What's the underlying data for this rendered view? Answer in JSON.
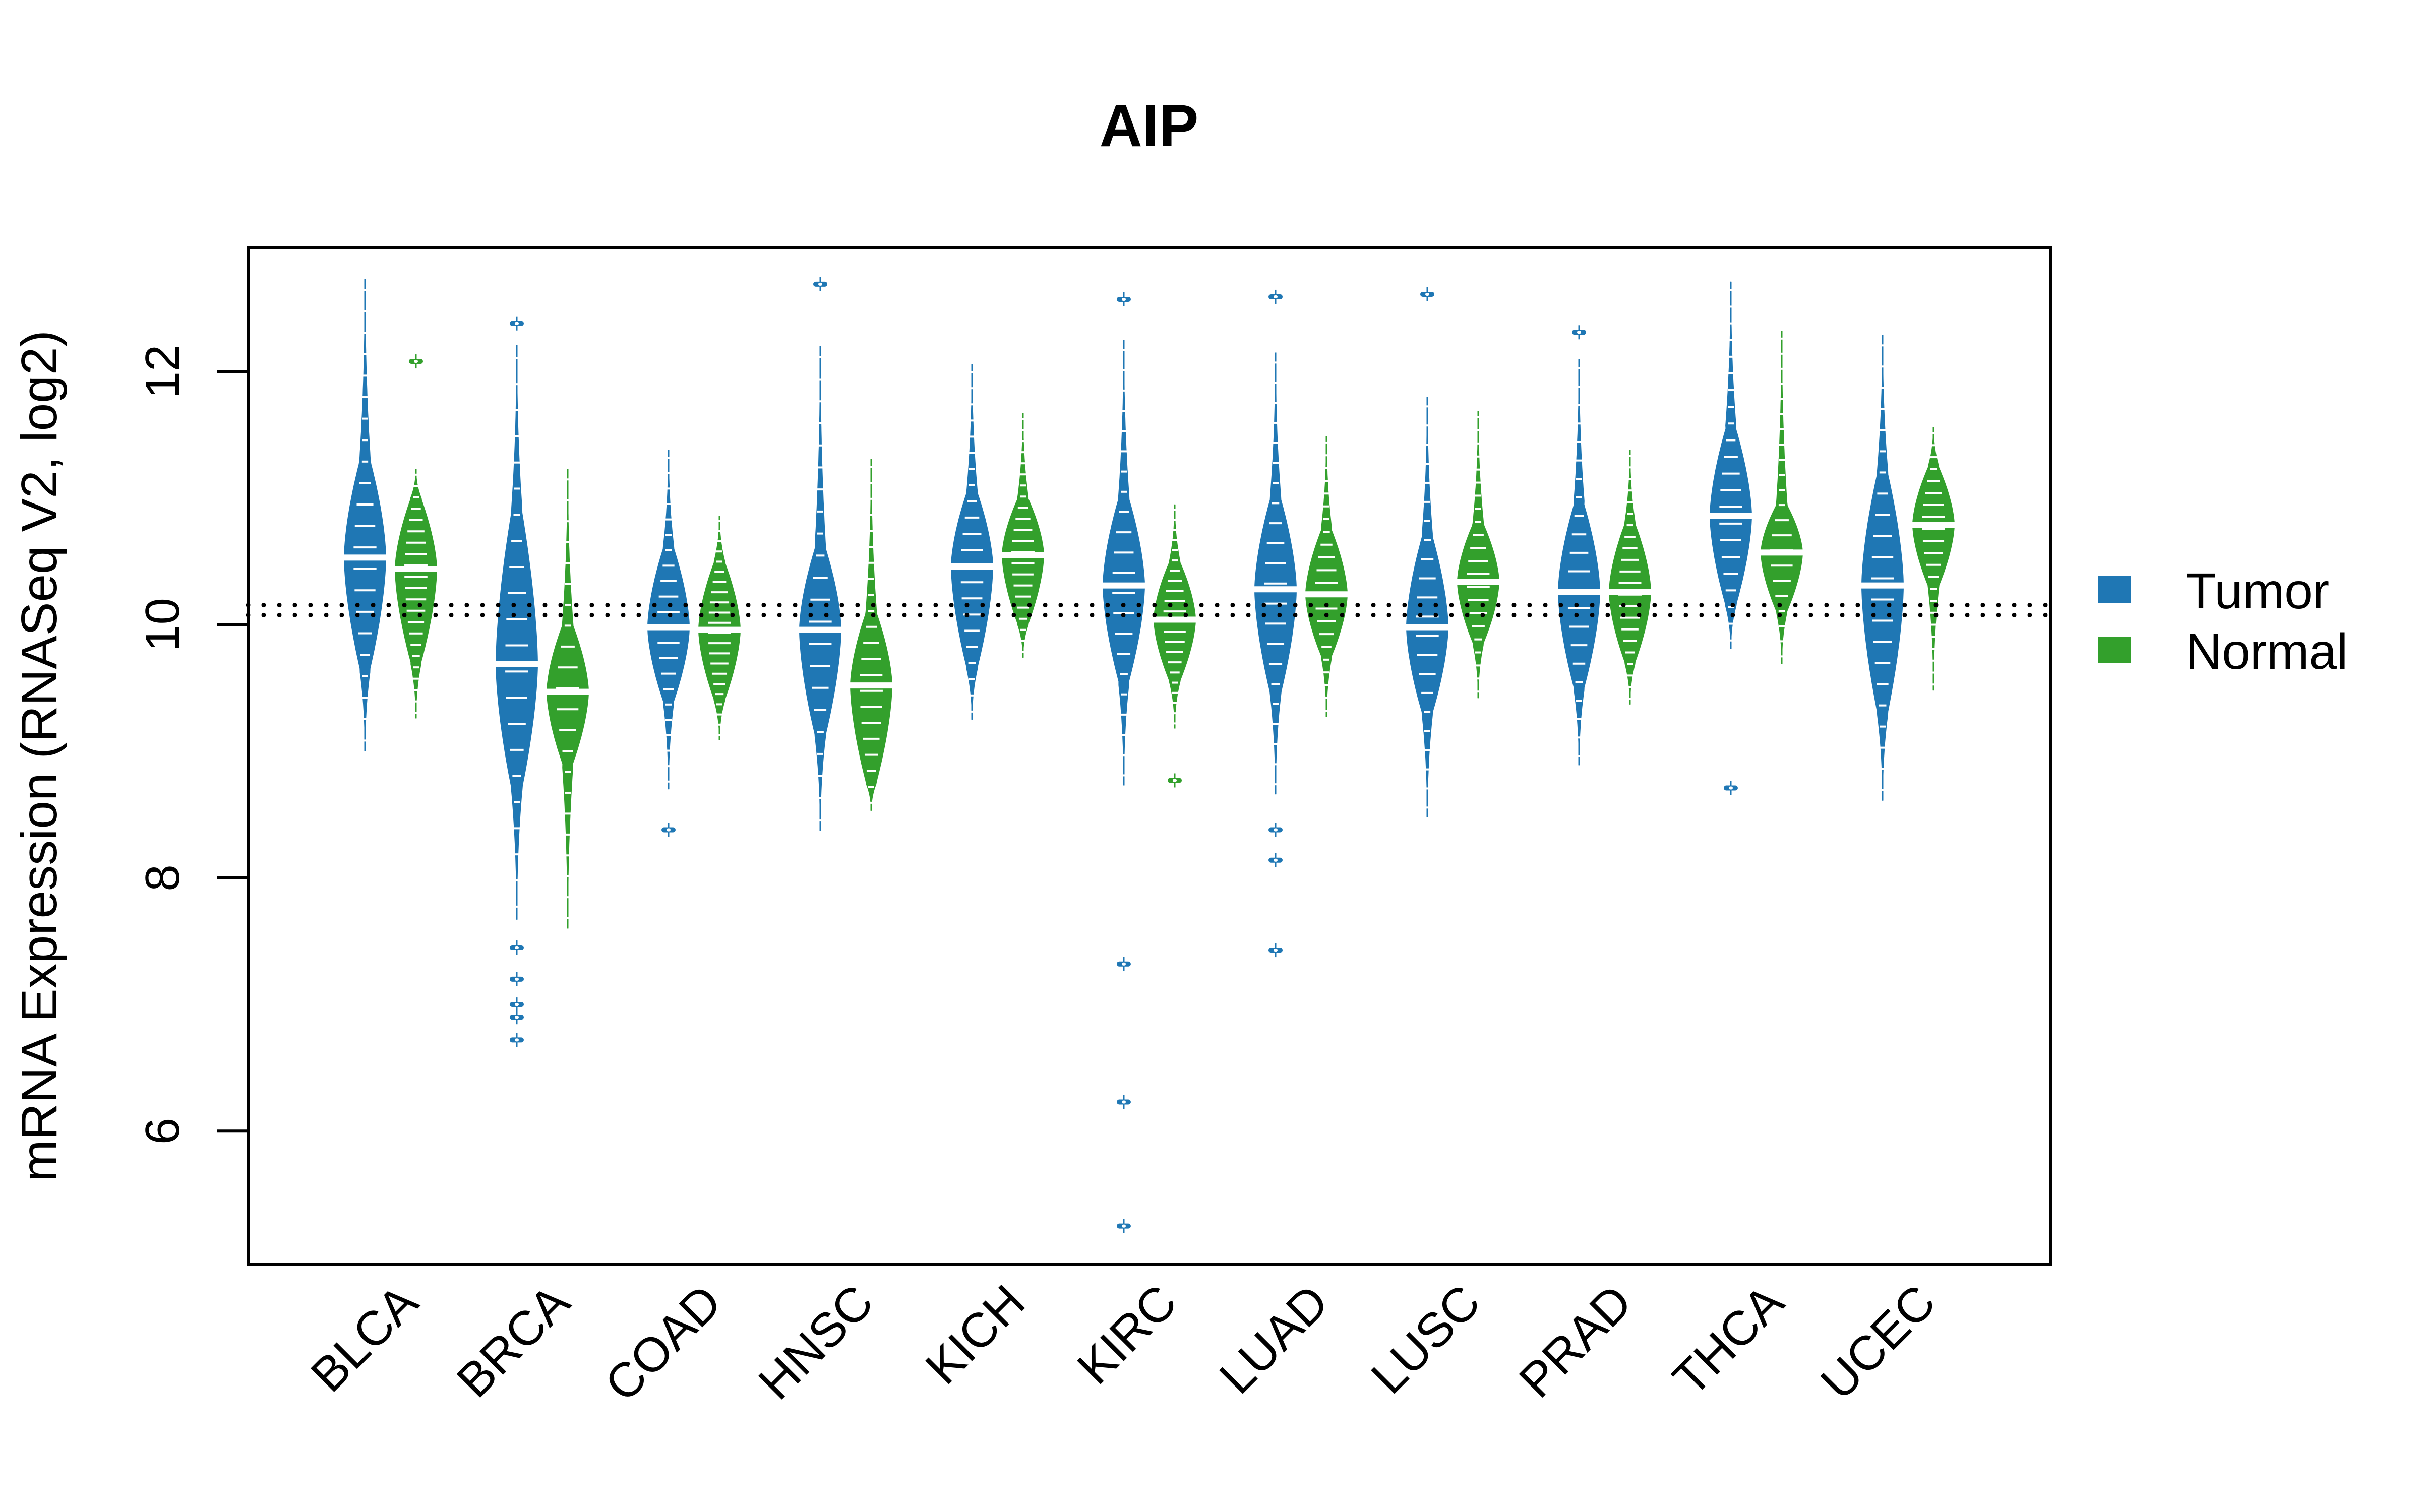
{
  "chart_data": {
    "type": "violin",
    "title": "AIP",
    "xlabel": "",
    "ylabel": "mRNA Expression (RNASeq V2, log2)",
    "ylim": [
      4.95,
      12.98
    ],
    "yticks": [
      6,
      8,
      10,
      12
    ],
    "grid": false,
    "legend": {
      "placement": "right",
      "entries": [
        {
          "name": "Tumor",
          "color": "#1F77B4"
        },
        {
          "name": "Normal",
          "color": "#33A02C"
        }
      ]
    },
    "reference_lines": [
      {
        "value": 10.155,
        "style": "dotted"
      },
      {
        "value": 10.076,
        "style": "dotted"
      }
    ],
    "categories": [
      "BLCA",
      "BRCA",
      "COAD",
      "HNSC",
      "KICH",
      "KIRC",
      "LUAD",
      "LUSC",
      "PRAD",
      "THCA",
      "UCEC"
    ],
    "series": [
      {
        "name": "Tumor",
        "color": "#1F77B4",
        "groups": [
          {
            "category": "BLCA",
            "median": 10.53,
            "min": 9.0,
            "max": 12.73,
            "body": [
              9.65,
              11.3
            ],
            "outliers": []
          },
          {
            "category": "BRCA",
            "median": 9.69,
            "min": 7.67,
            "max": 12.21,
            "body": [
              8.7,
              10.9
            ],
            "outliers": [
              12.38,
              7.45,
              7.2,
              7.0,
              6.9,
              6.72
            ]
          },
          {
            "category": "COAD",
            "median": 9.98,
            "min": 8.7,
            "max": 11.38,
            "body": [
              9.39,
              10.61
            ],
            "outliers": [
              8.38
            ]
          },
          {
            "category": "HNSC",
            "median": 9.96,
            "min": 8.37,
            "max": 12.2,
            "body": [
              9.12,
              10.61
            ],
            "outliers": [
              12.69
            ]
          },
          {
            "category": "KICH",
            "median": 10.46,
            "min": 9.25,
            "max": 12.06,
            "body": [
              9.65,
              11.05
            ],
            "outliers": []
          },
          {
            "category": "KIRC",
            "median": 10.31,
            "min": 8.73,
            "max": 12.25,
            "body": [
              9.55,
              11.0
            ],
            "outliers": [
              12.57,
              7.32,
              6.23,
              5.25
            ]
          },
          {
            "category": "LUAD",
            "median": 10.28,
            "min": 8.66,
            "max": 12.15,
            "body": [
              9.45,
              11.0
            ],
            "outliers": [
              12.59,
              8.38,
              8.14,
              7.43
            ]
          },
          {
            "category": "LUSC",
            "median": 9.98,
            "min": 8.48,
            "max": 11.8,
            "body": [
              9.3,
              10.7
            ],
            "outliers": [
              12.61
            ]
          },
          {
            "category": "PRAD",
            "median": 10.26,
            "min": 8.89,
            "max": 12.1,
            "body": [
              9.5,
              10.95
            ],
            "outliers": [
              12.31
            ]
          },
          {
            "category": "THCA",
            "median": 10.86,
            "min": 9.81,
            "max": 12.71,
            "body": [
              10.15,
              11.55
            ],
            "outliers": [
              8.71
            ]
          },
          {
            "category": "UCEC",
            "median": 10.31,
            "min": 8.61,
            "max": 12.29,
            "body": [
              9.3,
              11.2
            ],
            "outliers": []
          }
        ]
      },
      {
        "name": "Normal",
        "color": "#33A02C",
        "groups": [
          {
            "category": "BLCA",
            "median": 10.44,
            "min": 9.26,
            "max": 11.23,
            "body": [
              9.7,
              11.0
            ],
            "outliers": [
              12.08
            ]
          },
          {
            "category": "BRCA",
            "median": 9.47,
            "min": 7.6,
            "max": 11.23,
            "body": [
              8.9,
              10.0
            ],
            "outliers": []
          },
          {
            "category": "COAD",
            "median": 9.96,
            "min": 9.09,
            "max": 10.86,
            "body": [
              9.4,
              10.5
            ],
            "outliers": []
          },
          {
            "category": "HNSC",
            "median": 9.52,
            "min": 8.53,
            "max": 11.31,
            "body": [
              8.75,
              10.1
            ],
            "outliers": []
          },
          {
            "category": "KICH",
            "median": 10.55,
            "min": 9.74,
            "max": 11.67,
            "body": [
              10.0,
              11.0
            ],
            "outliers": []
          },
          {
            "category": "KIRC",
            "median": 10.04,
            "min": 9.18,
            "max": 10.95,
            "body": [
              9.55,
              10.5
            ],
            "outliers": [
              8.77
            ]
          },
          {
            "category": "LUAD",
            "median": 10.24,
            "min": 9.27,
            "max": 11.49,
            "body": [
              9.75,
              10.75
            ],
            "outliers": []
          },
          {
            "category": "LUSC",
            "median": 10.34,
            "min": 9.42,
            "max": 11.69,
            "body": [
              9.85,
              10.8
            ],
            "outliers": []
          },
          {
            "category": "PRAD",
            "median": 10.26,
            "min": 9.37,
            "max": 11.38,
            "body": [
              9.7,
              10.8
            ],
            "outliers": []
          },
          {
            "category": "THCA",
            "median": 10.57,
            "min": 9.69,
            "max": 12.32,
            "body": [
              10.1,
              10.95
            ],
            "outliers": []
          },
          {
            "category": "UCEC",
            "median": 10.79,
            "min": 9.48,
            "max": 11.56,
            "body": [
              10.3,
              11.25
            ],
            "outliers": []
          }
        ]
      }
    ]
  }
}
